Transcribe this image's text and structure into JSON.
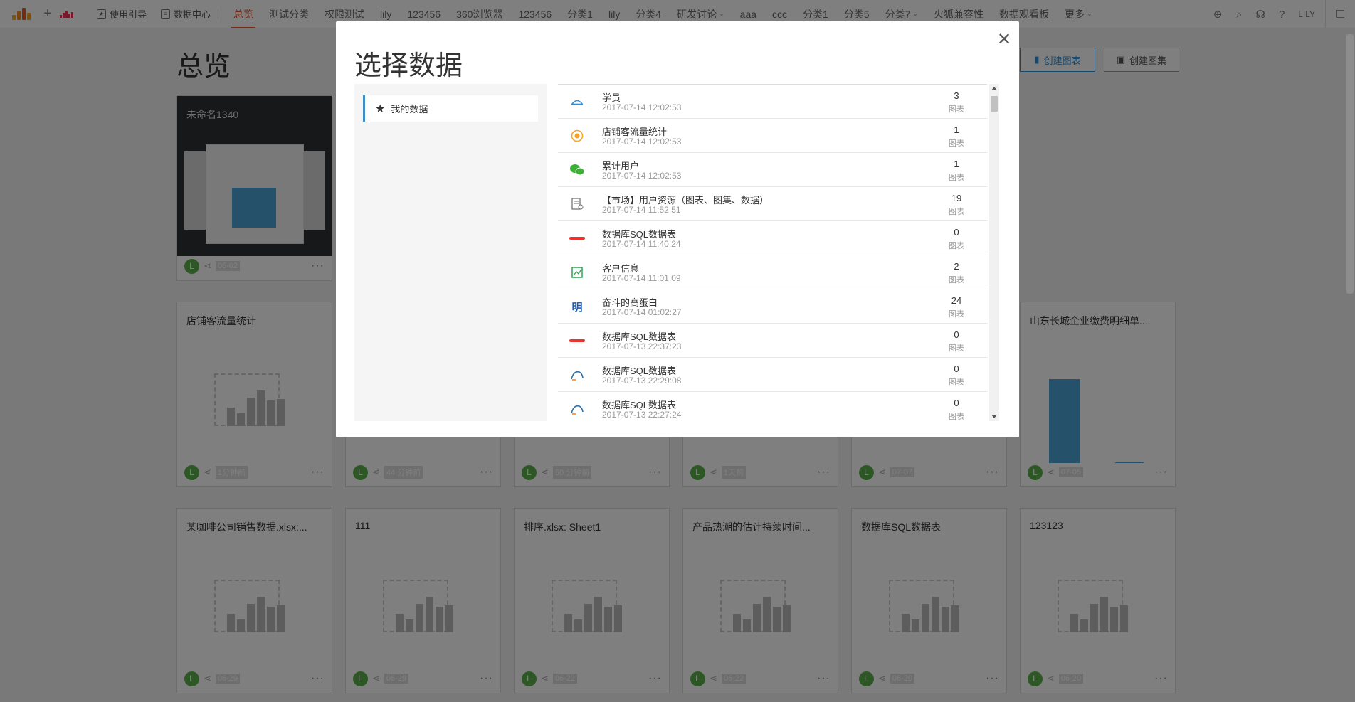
{
  "nav": {
    "guide": "使用引导",
    "data_center": "数据中心",
    "tabs": [
      {
        "label": "总览"
      },
      {
        "label": "测试分类"
      },
      {
        "label": "权限测试"
      },
      {
        "label": "lily"
      },
      {
        "label": "123456"
      },
      {
        "label": "360浏览器"
      },
      {
        "label": "123456"
      },
      {
        "label": "分类1"
      },
      {
        "label": "lily"
      },
      {
        "label": "分类4"
      },
      {
        "label": "研发讨论"
      },
      {
        "label": "aaa"
      },
      {
        "label": "ccc"
      },
      {
        "label": "分类1"
      },
      {
        "label": "分类5"
      },
      {
        "label": "分类7"
      },
      {
        "label": "火狐兼容性"
      },
      {
        "label": "数据观看板"
      },
      {
        "label": "更多"
      }
    ],
    "user": "LILY"
  },
  "page": {
    "title": "总览",
    "create_chart": "创建图表",
    "create_set": "创建图集"
  },
  "cards": [
    {
      "title": "未命名1340",
      "time": "06-02",
      "avatar": "L"
    },
    {
      "title": "店铺客流量统计",
      "time": "1分钟前",
      "avatar": "L"
    },
    {
      "title": "",
      "time": "44 分钟前",
      "avatar": "L"
    },
    {
      "title": "",
      "time": "50 分钟前",
      "avatar": "L"
    },
    {
      "title": "",
      "time": "1天前",
      "avatar": "L"
    },
    {
      "title": "",
      "time": "07-07",
      "avatar": "L"
    },
    {
      "title": "山东长城企业缴费明细单....",
      "time": "07-05",
      "avatar": "L"
    },
    {
      "title": "某咖啡公司销售数据.xlsx:...",
      "time": "06-29",
      "avatar": "L"
    },
    {
      "title": "111",
      "time": "06-29",
      "avatar": "L"
    },
    {
      "title": "排序.xlsx: Sheet1",
      "time": "06-22",
      "avatar": "L"
    },
    {
      "title": "产品热潮的估计持续时间...",
      "time": "06-22",
      "avatar": "L"
    },
    {
      "title": "数据库SQL数据表",
      "time": "06-20",
      "avatar": "L"
    },
    {
      "title": "123123",
      "time": "06-20",
      "avatar": "L"
    }
  ],
  "modal": {
    "title": "选择数据",
    "left_item": "我的数据",
    "unit": "图表",
    "rows": [
      {
        "name": "学员",
        "date": "2017-07-14 12:02:53",
        "count": "3",
        "icon": "cloud-icon"
      },
      {
        "name": "店铺客流量统计",
        "date": "2017-07-14 12:02:53",
        "count": "1",
        "icon": "store-icon"
      },
      {
        "name": "累计用户",
        "date": "2017-07-14 12:02:53",
        "count": "1",
        "icon": "wechat-icon"
      },
      {
        "name": "【市场】用户资源（图表、图集、数据）",
        "date": "2017-07-14 11:52:51",
        "count": "19",
        "icon": "doc-list-icon"
      },
      {
        "name": "数据库SQL数据表",
        "date": "2017-07-14 11:40:24",
        "count": "0",
        "icon": "oracle-icon"
      },
      {
        "name": "客户信息",
        "date": "2017-07-14 11:01:09",
        "count": "2",
        "icon": "sheet-icon"
      },
      {
        "name": "奋斗的高蛋白",
        "date": "2017-07-14 01:02:27",
        "count": "24",
        "icon": "ming-icon"
      },
      {
        "name": "数据库SQL数据表",
        "date": "2017-07-13 22:37:23",
        "count": "0",
        "icon": "oracle-icon"
      },
      {
        "name": "数据库SQL数据表",
        "date": "2017-07-13 22:29:08",
        "count": "0",
        "icon": "mysql-icon"
      },
      {
        "name": "数据库SQL数据表",
        "date": "2017-07-13 22:27:24",
        "count": "0",
        "icon": "mysql-icon"
      }
    ]
  },
  "colors": {
    "accent": "#e8552e",
    "primary": "#2f8ed5",
    "avatar": "#5bb04c",
    "chart_blue": "#4aa3d6"
  }
}
